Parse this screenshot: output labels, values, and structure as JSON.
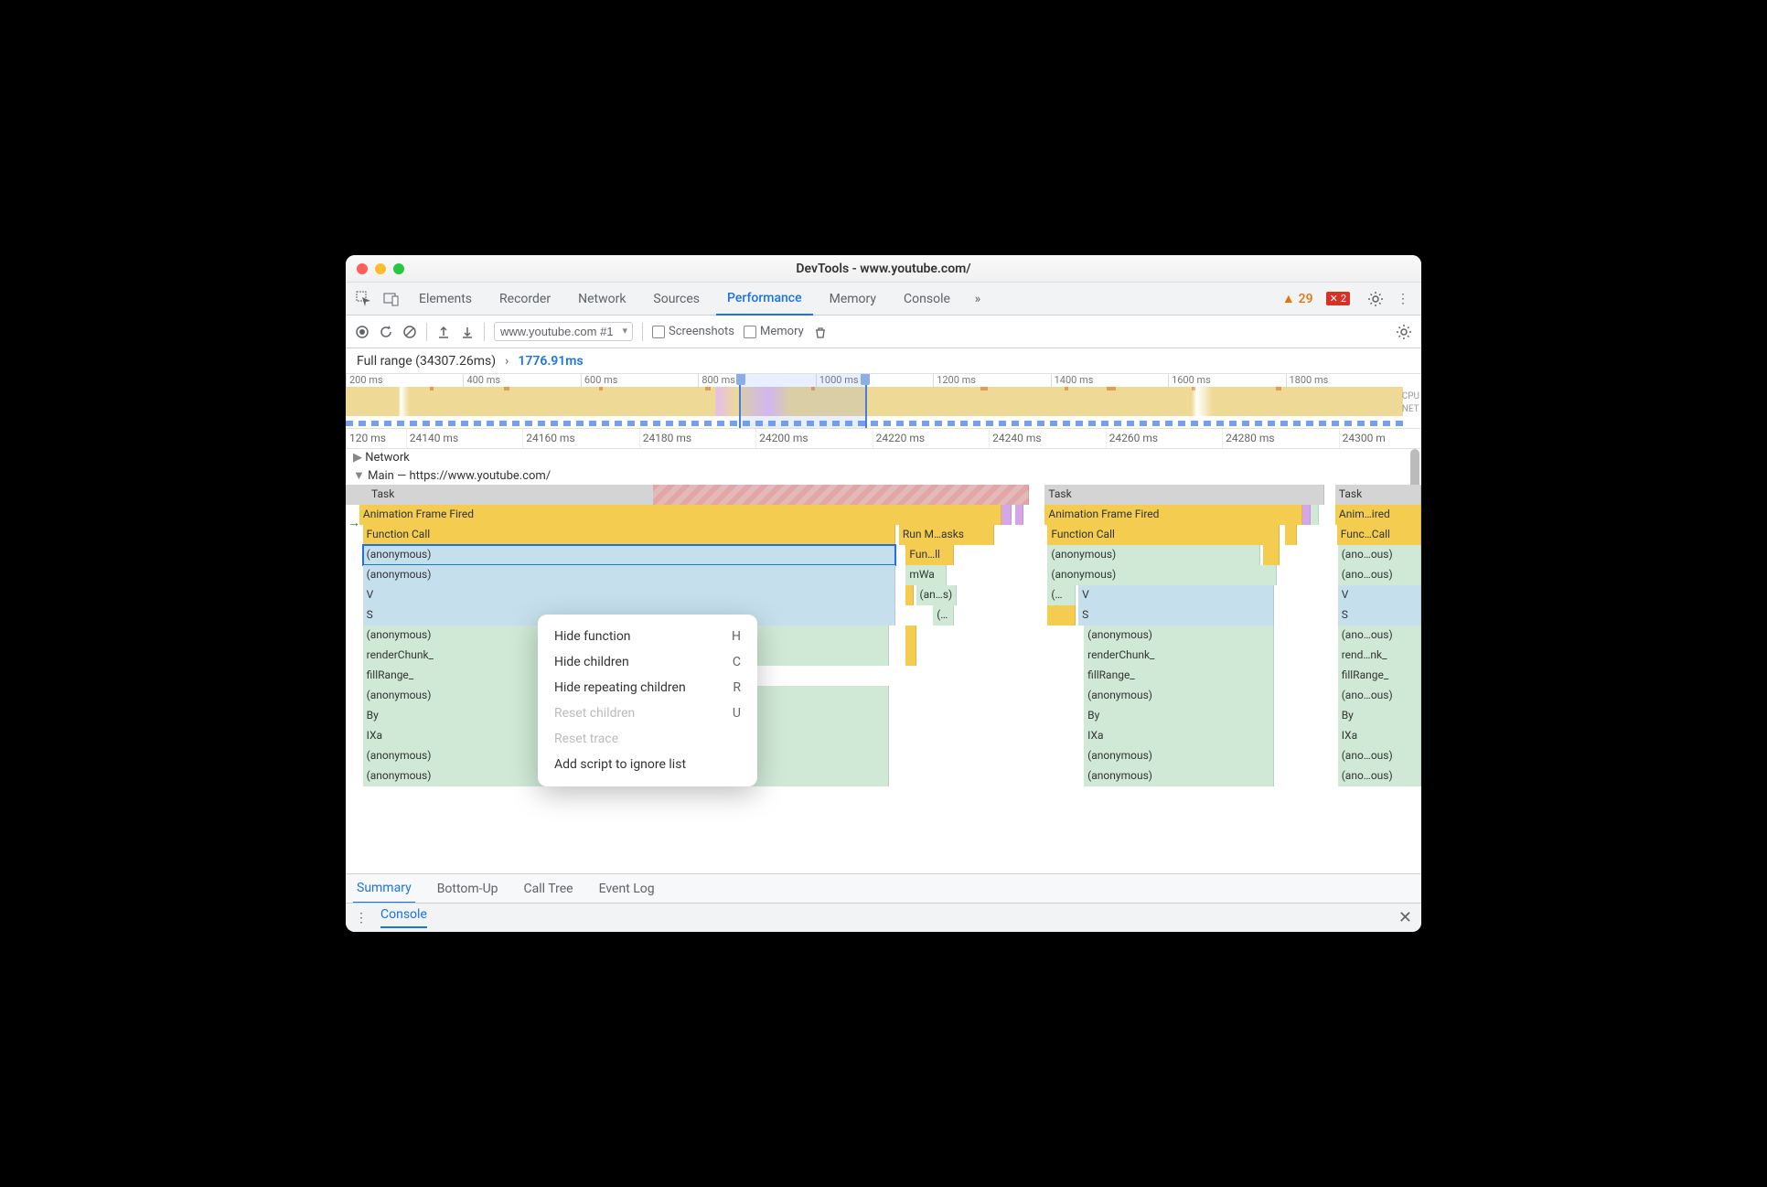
{
  "title": "DevTools - www.youtube.com/",
  "tabs": [
    "Elements",
    "Recorder",
    "Network",
    "Sources",
    "Performance",
    "Memory",
    "Console"
  ],
  "active_tab": "Performance",
  "warn_count": "29",
  "err_count": "2",
  "toolbar": {
    "recording_dropdown": "www.youtube.com #1",
    "screenshots_label": "Screenshots",
    "memory_label": "Memory"
  },
  "breadcrumb": {
    "full": "Full range (34307.26ms)",
    "selected": "1776.91ms"
  },
  "overview_ticks": [
    "200 ms",
    "400 ms",
    "600 ms",
    "800 ms",
    "1000 ms",
    "1200 ms",
    "1400 ms",
    "1600 ms",
    "1800 ms"
  ],
  "overview_labels": {
    "cpu": "CPU",
    "net": "NET"
  },
  "detail_ticks": [
    "120 ms",
    "24140 ms",
    "24160 ms",
    "24180 ms",
    "24200 ms",
    "24220 ms",
    "24240 ms",
    "24260 ms",
    "24280 ms",
    "24300 m"
  ],
  "tracks": {
    "network": "Network",
    "main": "Main — https://www.youtube.com/"
  },
  "flame": {
    "task": "Task",
    "af": "Animation Frame Fired",
    "af3": "Anim…ired",
    "fc": "Function Call",
    "fc3": "Func…Call",
    "runm": "Run M…asks",
    "funll": "Fun…ll",
    "mwa": "mWa",
    "ans": "(an…s)",
    "opp": "(…",
    "anon": "(anonymous)",
    "anon_s": "(ano…ous)",
    "v": "V",
    "s": "S",
    "render": "renderChunk_",
    "render_s": "rend…nk_",
    "fill": "fillRange_",
    "by": "By",
    "ixa": "IXa"
  },
  "context_menu": {
    "items": [
      {
        "label": "Hide function",
        "shortcut": "H",
        "disabled": false
      },
      {
        "label": "Hide children",
        "shortcut": "C",
        "disabled": false
      },
      {
        "label": "Hide repeating children",
        "shortcut": "R",
        "disabled": false
      },
      {
        "label": "Reset children",
        "shortcut": "U",
        "disabled": true
      },
      {
        "label": "Reset trace",
        "shortcut": "",
        "disabled": true
      },
      {
        "label": "Add script to ignore list",
        "shortcut": "",
        "disabled": false
      }
    ]
  },
  "bottom_tabs": [
    "Summary",
    "Bottom-Up",
    "Call Tree",
    "Event Log"
  ],
  "active_bottom_tab": "Summary",
  "drawer": {
    "label": "Console"
  }
}
